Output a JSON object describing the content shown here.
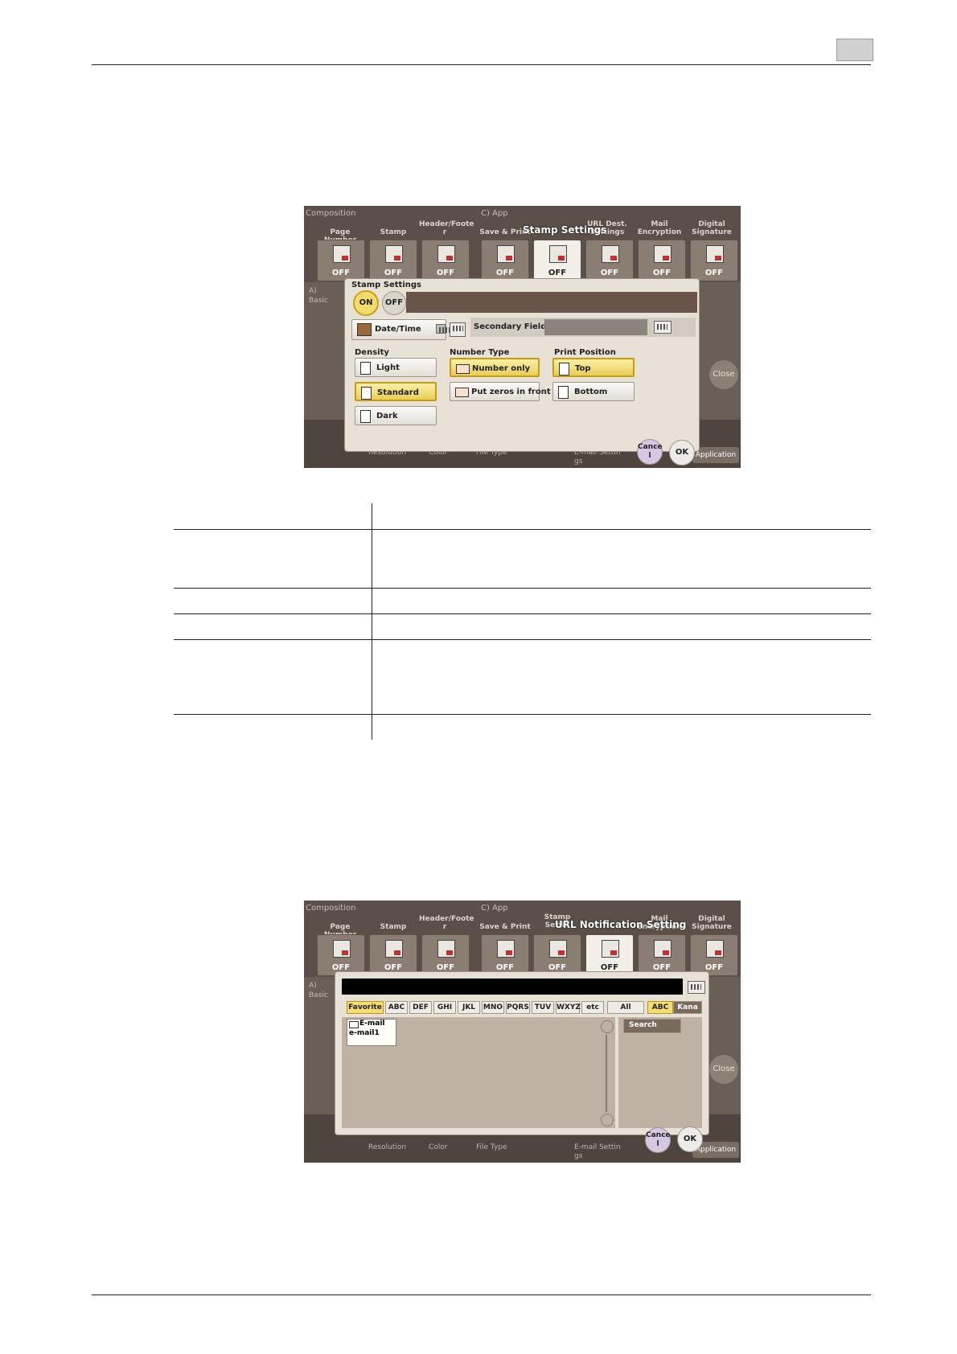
{
  "stamp_shot": {
    "groups": {
      "composition": "Composition",
      "app": "C)  App",
      "basic": "A)\nBasic"
    },
    "title": "Stamp Settings",
    "tiles": [
      {
        "label": "Page Number",
        "value": "OFF"
      },
      {
        "label": "Stamp",
        "value": "OFF"
      },
      {
        "label": "Header/Foote\nr",
        "value": "OFF"
      },
      {
        "label": "Save & Print",
        "value": "OFF"
      },
      {
        "label": "",
        "value": "OFF"
      },
      {
        "label": "URL Dest.\nSettings",
        "value": "OFF"
      },
      {
        "label": "Mail\nEncryption",
        "value": "OFF"
      },
      {
        "label": "Digital\nSignature",
        "value": "OFF"
      }
    ],
    "dialog": {
      "title": "Stamp Settings",
      "on": "ON",
      "off": "OFF",
      "date_time": "Date/Time",
      "secondary_field": "Secondary Field",
      "density_label": "Density",
      "density": [
        "Light",
        "Standard",
        "Dark"
      ],
      "number_type_label": "Number Type",
      "number_type": [
        "Number only",
        "Put zeros in front"
      ],
      "print_position_label": "Print Position",
      "print_position": [
        "Top",
        "Bottom"
      ],
      "cancel": "Cance\nl",
      "ok": "OK"
    },
    "close": "Close",
    "application": "Application",
    "bottom": [
      "Resolution",
      "Color",
      "File Type",
      "E-mail Settin\ngs"
    ]
  },
  "url_shot": {
    "groups": {
      "composition": "Composition",
      "app": "C)  App",
      "basic": "A)\nBasic"
    },
    "title": "URL Notification Setting",
    "tiles": [
      {
        "label": "Page Number",
        "value": "OFF"
      },
      {
        "label": "Stamp",
        "value": "OFF"
      },
      {
        "label": "Header/Foote\nr",
        "value": "OFF"
      },
      {
        "label": "Save & Print",
        "value": "OFF"
      },
      {
        "label": "Stamp Settin",
        "value": "OFF"
      },
      {
        "label": "",
        "value": "OFF"
      },
      {
        "label": "Mail\nEncryption",
        "value": "OFF"
      },
      {
        "label": "Digital\nSignature",
        "value": "OFF"
      }
    ],
    "dialog": {
      "tabs": [
        "Favorite",
        "ABC",
        "DEF",
        "GHI",
        "JKL",
        "MNO",
        "PQRS",
        "TUV",
        "WXYZ",
        "etc",
        "All"
      ],
      "mode_tabs": [
        "ABC",
        "Kana"
      ],
      "search": "Search",
      "entry_type": "E-mail",
      "entry_name": "e-mail1",
      "cancel": "Cance\nl",
      "ok": "OK"
    },
    "close": "Close",
    "application": "Application",
    "bottom": [
      "Resolution",
      "Color",
      "File Type",
      "E-mail Settin\ngs"
    ]
  }
}
